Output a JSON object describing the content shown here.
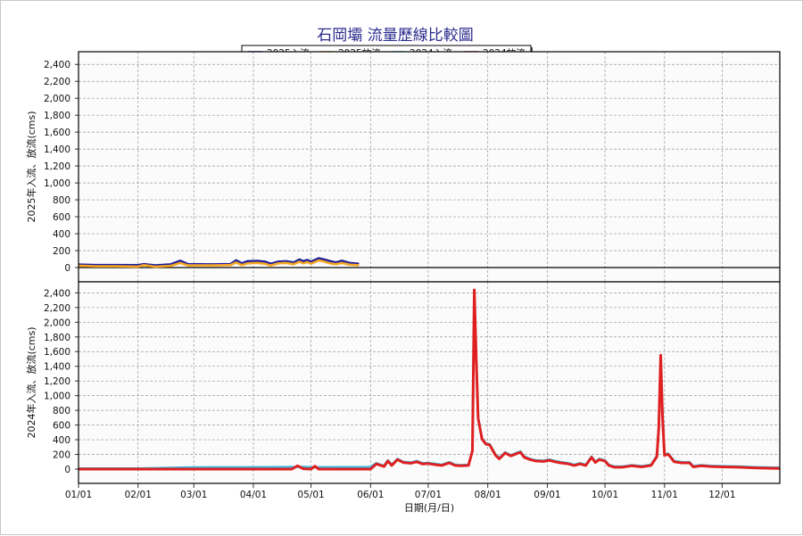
{
  "chart_data": {
    "type": "line",
    "title": "石岡壩 流量歷線比較圖",
    "xlabel": "日期(月/日)",
    "x_ticks": [
      "01/01",
      "02/01",
      "03/01",
      "04/01",
      "05/01",
      "06/01",
      "07/01",
      "08/01",
      "09/01",
      "10/01",
      "11/01",
      "12/01"
    ],
    "y_ticks": [
      "0",
      "200",
      "400",
      "600",
      "800",
      "1,000",
      "1,200",
      "1,400",
      "1,600",
      "1,800",
      "2,000",
      "2,200",
      "2,400"
    ],
    "grid": true,
    "legend_position": "top-center",
    "legend": [
      {
        "label": "2025入流",
        "color": "#1c1c9c"
      },
      {
        "label": "2025放流",
        "color": "#f5a623"
      },
      {
        "label": "2024入流",
        "color": "#3bb8e0"
      },
      {
        "label": "2024放流",
        "color": "#e02020"
      }
    ],
    "panels": [
      {
        "ylabel": "2025年入流、放流(cms)",
        "ylim": [
          0,
          2550
        ],
        "series": [
          {
            "name": "2025入流",
            "color": "#1c1c9c",
            "points": [
              [
                "01/01",
                35
              ],
              [
                "01/10",
                30
              ],
              [
                "01/20",
                30
              ],
              [
                "02/01",
                28
              ],
              [
                "02/04",
                40
              ],
              [
                "02/10",
                25
              ],
              [
                "02/18",
                38
              ],
              [
                "02/23",
                80
              ],
              [
                "02/27",
                40
              ],
              [
                "03/10",
                38
              ],
              [
                "03/20",
                40
              ],
              [
                "03/23",
                85
              ],
              [
                "03/26",
                50
              ],
              [
                "03/29",
                75
              ],
              [
                "04/03",
                78
              ],
              [
                "04/07",
                70
              ],
              [
                "04/10",
                45
              ],
              [
                "04/14",
                70
              ],
              [
                "04/18",
                75
              ],
              [
                "04/22",
                60
              ],
              [
                "04/25",
                95
              ],
              [
                "04/27",
                75
              ],
              [
                "04/29",
                90
              ],
              [
                "05/01",
                70
              ],
              [
                "05/05",
                110
              ],
              [
                "05/08",
                95
              ],
              [
                "05/11",
                75
              ],
              [
                "05/14",
                60
              ],
              [
                "05/17",
                80
              ],
              [
                "05/21",
                55
              ],
              [
                "05/25",
                45
              ],
              [
                "05/26",
                45
              ]
            ]
          },
          {
            "name": "2025放流",
            "color": "#f5a623",
            "points": [
              [
                "01/01",
                22
              ],
              [
                "01/10",
                15
              ],
              [
                "01/20",
                15
              ],
              [
                "02/01",
                12
              ],
              [
                "02/04",
                28
              ],
              [
                "02/10",
                10
              ],
              [
                "02/18",
                20
              ],
              [
                "02/23",
                55
              ],
              [
                "02/27",
                25
              ],
              [
                "03/10",
                25
              ],
              [
                "03/20",
                28
              ],
              [
                "03/23",
                60
              ],
              [
                "03/26",
                30
              ],
              [
                "03/29",
                50
              ],
              [
                "04/03",
                55
              ],
              [
                "04/07",
                45
              ],
              [
                "04/10",
                25
              ],
              [
                "04/14",
                50
              ],
              [
                "04/18",
                55
              ],
              [
                "04/22",
                40
              ],
              [
                "04/25",
                70
              ],
              [
                "04/27",
                50
              ],
              [
                "04/29",
                65
              ],
              [
                "05/01",
                45
              ],
              [
                "05/05",
                85
              ],
              [
                "05/08",
                70
              ],
              [
                "05/11",
                50
              ],
              [
                "05/14",
                40
              ],
              [
                "05/17",
                55
              ],
              [
                "05/21",
                35
              ],
              [
                "05/25",
                28
              ],
              [
                "05/26",
                28
              ]
            ]
          }
        ]
      },
      {
        "ylabel": "2024年入流、放流(cms)",
        "ylim": [
          0,
          2550
        ],
        "series": [
          {
            "name": "2024入流",
            "color": "#3bb8e0",
            "points": [
              [
                "01/01",
                8
              ],
              [
                "02/01",
                8
              ],
              [
                "02/26",
                22
              ],
              [
                "03/10",
                25
              ],
              [
                "04/01",
                25
              ],
              [
                "04/28",
                30
              ],
              [
                "05/01",
                25
              ],
              [
                "05/30",
                28
              ],
              [
                "06/01",
                30
              ],
              [
                "06/04",
                80
              ],
              [
                "06/08",
                45
              ],
              [
                "06/10",
                120
              ],
              [
                "06/12",
                60
              ],
              [
                "06/15",
                140
              ],
              [
                "06/18",
                100
              ],
              [
                "06/22",
                90
              ],
              [
                "06/25",
                110
              ],
              [
                "06/28",
                80
              ],
              [
                "07/01",
                85
              ],
              [
                "07/05",
                70
              ],
              [
                "07/08",
                60
              ],
              [
                "07/12",
                95
              ],
              [
                "07/15",
                60
              ],
              [
                "07/18",
                55
              ],
              [
                "07/22",
                60
              ],
              [
                "07/24",
                260
              ],
              [
                "07/25",
                2420
              ],
              [
                "07/26",
                1500
              ],
              [
                "07/27",
                700
              ],
              [
                "07/29",
                420
              ],
              [
                "07/31",
                350
              ],
              [
                "08/02",
                340
              ],
              [
                "08/05",
                200
              ],
              [
                "08/07",
                150
              ],
              [
                "08/10",
                230
              ],
              [
                "08/13",
                190
              ],
              [
                "08/16",
                220
              ],
              [
                "08/18",
                240
              ],
              [
                "08/20",
                170
              ],
              [
                "08/23",
                140
              ],
              [
                "08/26",
                120
              ],
              [
                "08/30",
                115
              ],
              [
                "09/02",
                130
              ],
              [
                "09/05",
                110
              ],
              [
                "09/08",
                95
              ],
              [
                "09/12",
                80
              ],
              [
                "09/15",
                60
              ],
              [
                "09/18",
                80
              ],
              [
                "09/21",
                60
              ],
              [
                "09/24",
                170
              ],
              [
                "09/26",
                100
              ],
              [
                "09/28",
                140
              ],
              [
                "10/01",
                120
              ],
              [
                "10/03",
                60
              ],
              [
                "10/06",
                35
              ],
              [
                "10/10",
                35
              ],
              [
                "10/15",
                55
              ],
              [
                "10/20",
                40
              ],
              [
                "10/25",
                60
              ],
              [
                "10/28",
                180
              ],
              [
                "10/29",
                560
              ],
              [
                "10/30",
                1530
              ],
              [
                "10/31",
                700
              ],
              [
                "11/01",
                200
              ],
              [
                "11/03",
                210
              ],
              [
                "11/06",
                110
              ],
              [
                "11/10",
                95
              ],
              [
                "11/14",
                95
              ],
              [
                "11/16",
                40
              ],
              [
                "11/20",
                55
              ],
              [
                "11/25",
                45
              ],
              [
                "12/01",
                40
              ],
              [
                "12/10",
                35
              ],
              [
                "12/15",
                30
              ],
              [
                "12/20",
                25
              ],
              [
                "12/31",
                20
              ]
            ]
          },
          {
            "name": "2024放流",
            "color": "#e02020",
            "points": [
              [
                "01/01",
                0
              ],
              [
                "02/01",
                0
              ],
              [
                "03/01",
                0
              ],
              [
                "04/01",
                0
              ],
              [
                "04/21",
                0
              ],
              [
                "04/24",
                45
              ],
              [
                "04/27",
                5
              ],
              [
                "05/01",
                0
              ],
              [
                "05/03",
                40
              ],
              [
                "05/05",
                0
              ],
              [
                "05/30",
                0
              ],
              [
                "06/01",
                0
              ],
              [
                "06/04",
                70
              ],
              [
                "06/08",
                35
              ],
              [
                "06/10",
                110
              ],
              [
                "06/12",
                50
              ],
              [
                "06/15",
                130
              ],
              [
                "06/18",
                90
              ],
              [
                "06/22",
                80
              ],
              [
                "06/25",
                100
              ],
              [
                "06/28",
                70
              ],
              [
                "07/01",
                75
              ],
              [
                "07/05",
                60
              ],
              [
                "07/08",
                50
              ],
              [
                "07/12",
                85
              ],
              [
                "07/15",
                50
              ],
              [
                "07/18",
                45
              ],
              [
                "07/22",
                50
              ],
              [
                "07/24",
                250
              ],
              [
                "07/25",
                2440
              ],
              [
                "07/26",
                1480
              ],
              [
                "07/27",
                690
              ],
              [
                "07/29",
                410
              ],
              [
                "07/31",
                340
              ],
              [
                "08/02",
                330
              ],
              [
                "08/05",
                190
              ],
              [
                "08/07",
                140
              ],
              [
                "08/10",
                220
              ],
              [
                "08/13",
                180
              ],
              [
                "08/16",
                210
              ],
              [
                "08/18",
                230
              ],
              [
                "08/20",
                160
              ],
              [
                "08/23",
                130
              ],
              [
                "08/26",
                110
              ],
              [
                "08/30",
                105
              ],
              [
                "09/02",
                120
              ],
              [
                "09/05",
                100
              ],
              [
                "09/08",
                85
              ],
              [
                "09/12",
                70
              ],
              [
                "09/15",
                50
              ],
              [
                "09/18",
                70
              ],
              [
                "09/21",
                50
              ],
              [
                "09/24",
                160
              ],
              [
                "09/26",
                90
              ],
              [
                "09/28",
                130
              ],
              [
                "10/01",
                110
              ],
              [
                "10/03",
                50
              ],
              [
                "10/06",
                25
              ],
              [
                "10/10",
                25
              ],
              [
                "10/15",
                45
              ],
              [
                "10/20",
                30
              ],
              [
                "10/25",
                50
              ],
              [
                "10/28",
                170
              ],
              [
                "10/29",
                550
              ],
              [
                "10/30",
                1550
              ],
              [
                "10/31",
                690
              ],
              [
                "11/01",
                190
              ],
              [
                "11/03",
                200
              ],
              [
                "11/06",
                100
              ],
              [
                "11/10",
                85
              ],
              [
                "11/14",
                85
              ],
              [
                "11/16",
                30
              ],
              [
                "11/20",
                45
              ],
              [
                "11/25",
                35
              ],
              [
                "12/01",
                30
              ],
              [
                "12/10",
                25
              ],
              [
                "12/15",
                20
              ],
              [
                "12/20",
                15
              ],
              [
                "12/31",
                10
              ]
            ]
          }
        ]
      }
    ]
  }
}
